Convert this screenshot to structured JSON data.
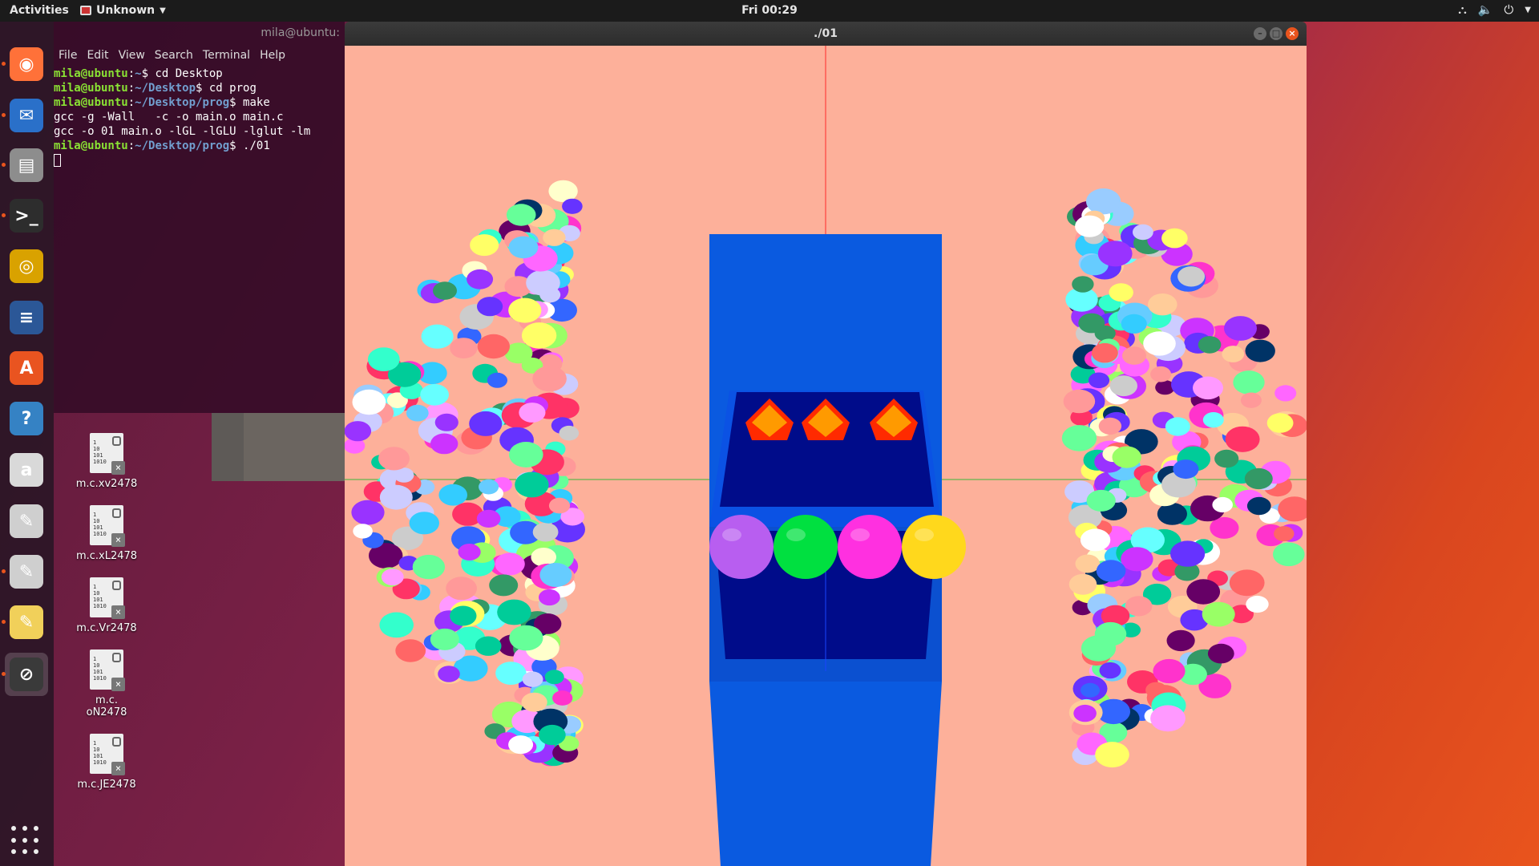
{
  "topbar": {
    "activities": "Activities",
    "app_name": "Unknown",
    "clock": "Fri 00:29",
    "icons": [
      "network-icon",
      "volume-icon",
      "power-icon",
      "menu-caret-icon"
    ]
  },
  "dock": {
    "items": [
      {
        "name": "firefox",
        "color": "#ff7139",
        "glyph": "◉"
      },
      {
        "name": "thunderbird",
        "color": "#2a70c9",
        "glyph": "✉"
      },
      {
        "name": "files",
        "color": "#8d8d8d",
        "glyph": "▤"
      },
      {
        "name": "terminal",
        "color": "#2d2d2d",
        "glyph": ">_"
      },
      {
        "name": "rhythmbox",
        "color": "#d9a200",
        "glyph": "◎"
      },
      {
        "name": "libreoffice-writer",
        "color": "#2b5797",
        "glyph": "≡"
      },
      {
        "name": "software-center",
        "color": "#e95420",
        "glyph": "A"
      },
      {
        "name": "help",
        "color": "#3582c4",
        "glyph": "?"
      },
      {
        "name": "amazon",
        "color": "#d9d9d9",
        "glyph": "a"
      },
      {
        "name": "text-editor-1",
        "color": "#cfcfcf",
        "glyph": "✎"
      },
      {
        "name": "text-editor-2",
        "color": "#cfcfcf",
        "glyph": "✎"
      },
      {
        "name": "notes",
        "color": "#f1d05a",
        "glyph": "✎"
      },
      {
        "name": "opengl-app",
        "color": "#3a3a3a",
        "glyph": "⊘"
      }
    ]
  },
  "desktop": {
    "icons": [
      {
        "label": "m.c.xv2478"
      },
      {
        "label": "m.c.xL2478"
      },
      {
        "label": "m.c.Vr2478"
      },
      {
        "label": "m.c.\noN2478"
      },
      {
        "label": "m.c.JE2478"
      }
    ]
  },
  "terminal": {
    "title": "mila@ubuntu:",
    "menu": [
      "File",
      "Edit",
      "View",
      "Search",
      "Terminal",
      "Help"
    ],
    "lines": [
      {
        "user": "mila@ubuntu",
        "path": "~",
        "cmd": "cd Desktop"
      },
      {
        "user": "mila@ubuntu",
        "path": "~/Desktop",
        "cmd": "cd prog"
      },
      {
        "user": "mila@ubuntu",
        "path": "~/Desktop/prog",
        "cmd": "make"
      },
      {
        "out": "gcc -g -Wall   -c -o main.o main.c"
      },
      {
        "out": "gcc -o 01 main.o -lGL -lGLU -lglut -lm"
      },
      {
        "user": "mila@ubuntu",
        "path": "~/Desktop/prog",
        "cmd": "./01"
      }
    ]
  },
  "glwindow": {
    "title": "./01",
    "background": "#fdb09a",
    "box_color": "#0a5ae0",
    "box_inner": "#000c8a",
    "gems_color": "#ff9a00",
    "balls": [
      "#b85ef0",
      "#00e040",
      "#ff30e0",
      "#ffd81c"
    ]
  }
}
